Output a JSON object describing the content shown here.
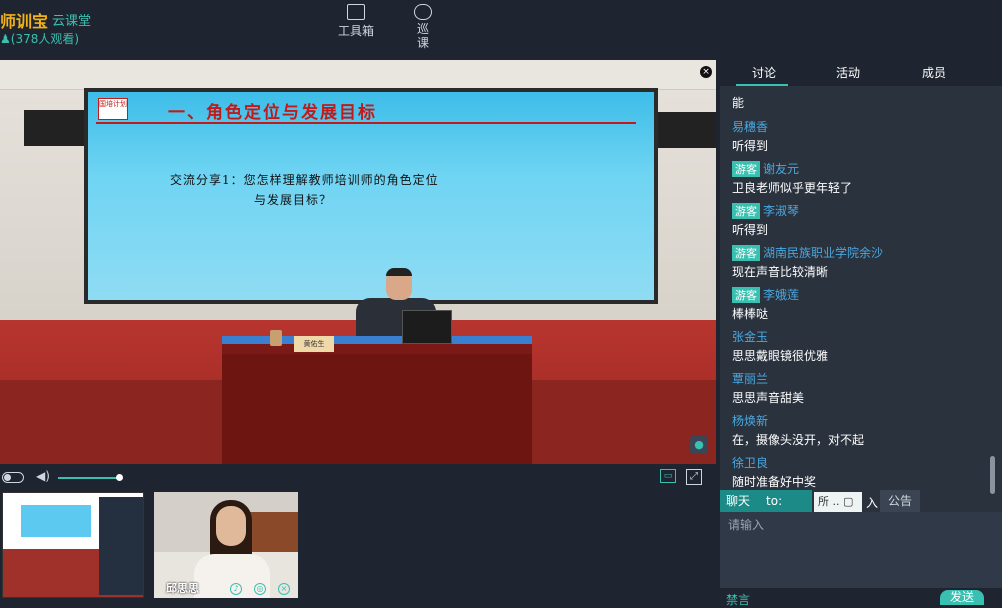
{
  "header": {
    "brand": "师训宝",
    "sub": "云课堂",
    "viewers": "(378人观看)",
    "toolbox_label": "工具箱",
    "patrol_label_top": "巡",
    "patrol_label_bottom": "课"
  },
  "slide": {
    "logo": "国培计划",
    "title": "一、角色定位与发展目标",
    "line1": "交流分享1：您怎样理解教师培训师的角色定位",
    "line2": "与发展目标？",
    "nameplate": "黄佑生"
  },
  "tabs": {
    "discussion": "讨论",
    "activity": "活动",
    "members": "成员"
  },
  "messages": [
    {
      "name": "",
      "guest": false,
      "text": "能"
    },
    {
      "name": "易穗香",
      "guest": false,
      "text": "听得到"
    },
    {
      "name": "谢友元",
      "guest": true,
      "text": "卫良老师似乎更年轻了"
    },
    {
      "name": "李淑琴",
      "guest": true,
      "text": "听得到"
    },
    {
      "name": "湖南民族职业学院余沙",
      "guest": true,
      "text": "现在声音比较清晰"
    },
    {
      "name": "李娥莲",
      "guest": true,
      "text": "棒棒哒"
    },
    {
      "name": "张金玉",
      "guest": false,
      "text": "思思戴眼镜很优雅"
    },
    {
      "name": "覃丽兰",
      "guest": false,
      "text": "思思声音甜美"
    },
    {
      "name": "杨焕新",
      "guest": false,
      "text": "在，摄像头没开，对不起"
    },
    {
      "name": "徐卫良",
      "guest": false,
      "text": "随时准备好中奖"
    }
  ],
  "guest_badge": "游客",
  "chat": {
    "tab_label": "聊天",
    "to_label": "to:",
    "recipient": "所",
    "in_label": "入",
    "notice_label": "公告",
    "input_placeholder": "请输入",
    "mute_label": "禁言",
    "send_label": "发送"
  },
  "thumb2_name": "邱思思"
}
